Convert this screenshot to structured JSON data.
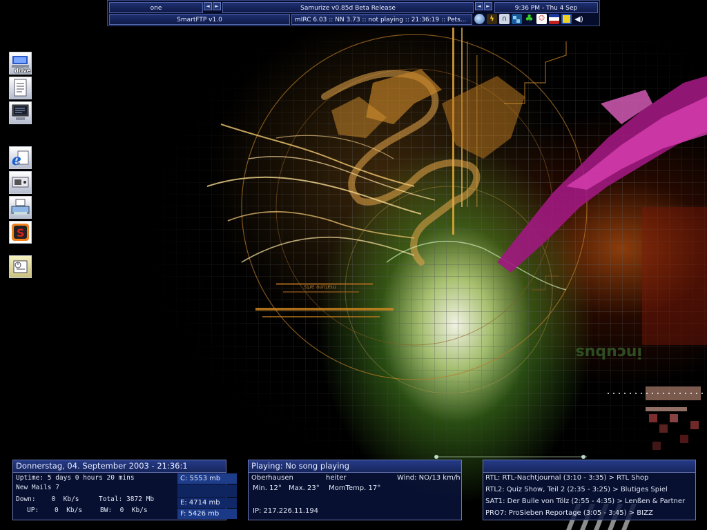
{
  "taskbar": {
    "task_one": "one",
    "samurize": "Samurize v0.85d Beta Release",
    "clock": "9:36 PM - Thu 4 Sep",
    "smartftp": "SmartFTP v1.0",
    "mirc": "mIRC 6.03 :: NN 3.73 :: not playing :: 21:36:19 :: Pets...",
    "arrow_left": "◄",
    "arrow_right": "►",
    "tray_icons": [
      "globe-icon",
      "lightning-icon",
      "headphones-icon",
      "network-icon",
      "clover-icon",
      "chat-icon",
      "flag-icon",
      "monitor-icon",
      "speaker-icon"
    ]
  },
  "desktop_icons": [
    {
      "name": "drive-icon",
      "label": "drive"
    },
    {
      "name": "document-icon",
      "label": ""
    },
    {
      "name": "my-computer-icon",
      "label": ""
    },
    {
      "name": "internet-explorer-icon",
      "label": ""
    },
    {
      "name": "control-panel-icon",
      "label": ""
    },
    {
      "name": "printer-icon",
      "label": ""
    },
    {
      "name": "app-s-icon",
      "label": ""
    },
    {
      "name": "scheduler-icon",
      "label": ""
    }
  ],
  "sysinfo": {
    "date": "Donnerstag, 04. September 2003 - 21:36:1",
    "uptime": "Uptime: 5 days 0 hours 20 mins",
    "mails": "New Mails 7",
    "down": "Down:    0  Kb/s",
    "up": "UP:    0  Kb/s",
    "total": "Total: 3872 Mb",
    "bw": "BW:  0  Kb/s",
    "drive_c": "C: 5553 mb",
    "drive_e": "E: 4714 mb",
    "drive_f": "F: 5426 mb"
  },
  "weather": {
    "playing": "Playing: No song playing",
    "city": "Oberhausen",
    "condition": "heiter",
    "wind": "Wind: NO/13 km/h",
    "min": "Min. 12°",
    "max": "Max. 23°",
    "momtemp": "MomTemp. 17°",
    "ip": "IP: 217.226.11.194"
  },
  "tv": {
    "lines": [
      "RTL: RTL-Nachtjournal (3:10 - 3:35) > RTL Shop",
      "RTL2: Quiz Show, Teil 2 (2:35 - 3:25) > Blutiges Spiel",
      "SAT1: Der Bulle von Tölz (2:55 - 4:35) > Lenßen & Partner",
      "PRO7: ProSieben Reportage (3:05 - 3:45) > BIZZ"
    ]
  },
  "wallpaper_text": {
    "incubus": "incubus",
    "small_caption": "sʇɹɐ ǝɹnʇɐɯ"
  },
  "colors": {
    "panel_bg": "#0a143c",
    "panel_border": "#6978b6",
    "accent_orange": "#e09a30",
    "accent_magenta": "#b0208c",
    "accent_green": "#9be050"
  }
}
